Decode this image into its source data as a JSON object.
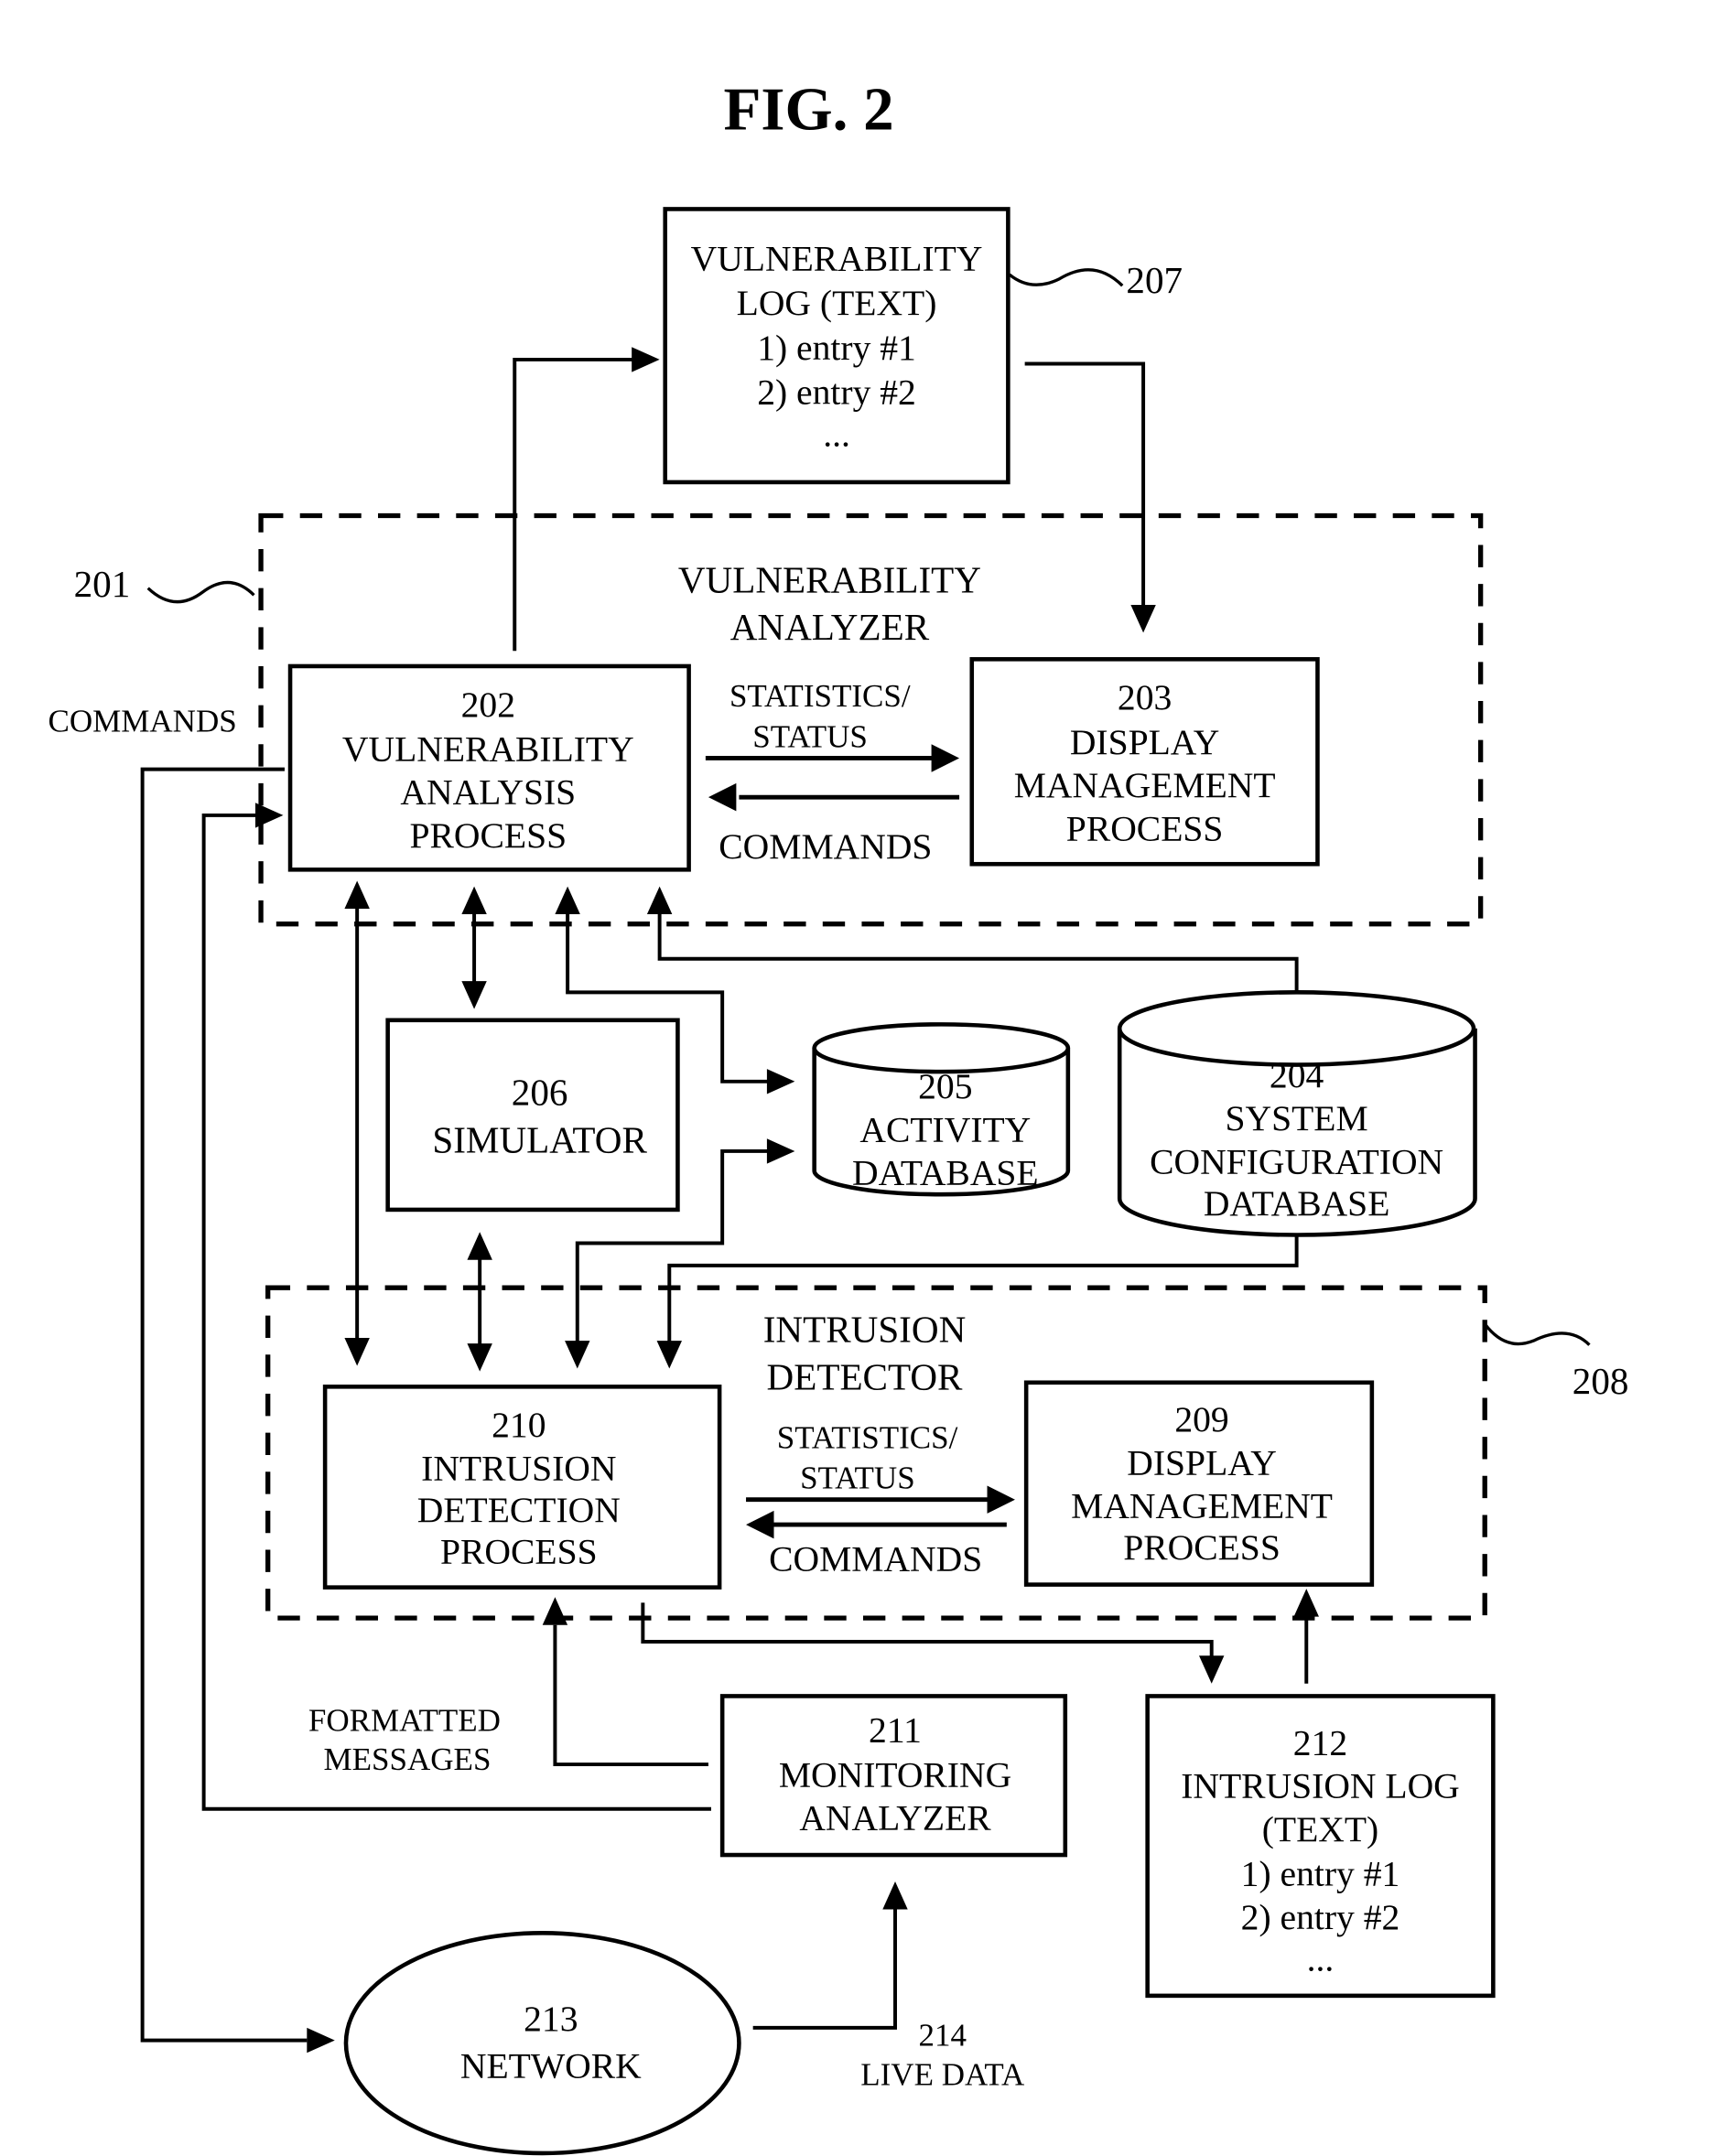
{
  "figure": {
    "title": "FIG. 2"
  },
  "groups": {
    "vulnerability_analyzer": {
      "ref": "201",
      "title_lines": [
        "VULNERABILITY",
        "ANALYZER"
      ]
    },
    "intrusion_detector": {
      "ref": "208",
      "title_lines": [
        "INTRUSION",
        "DETECTOR"
      ]
    }
  },
  "nodes": {
    "vulnerability_log": {
      "ref": "207",
      "lines": [
        "VULNERABILITY",
        "LOG (TEXT)",
        "1) entry #1",
        "2) entry #2",
        "..."
      ]
    },
    "vulnerability_analysis_process": {
      "lines": [
        "202",
        "VULNERABILITY",
        "ANALYSIS",
        "PROCESS"
      ]
    },
    "display_management_203": {
      "lines": [
        "203",
        "DISPLAY",
        "MANAGEMENT",
        "PROCESS"
      ]
    },
    "simulator": {
      "lines": [
        "206",
        "SIMULATOR"
      ]
    },
    "activity_database": {
      "lines": [
        "205",
        "ACTIVITY",
        "DATABASE"
      ]
    },
    "system_configuration_database": {
      "lines": [
        "204",
        "SYSTEM",
        "CONFIGURATION",
        "DATABASE"
      ]
    },
    "intrusion_detection_process": {
      "lines": [
        "210",
        "INTRUSION",
        "DETECTION",
        "PROCESS"
      ]
    },
    "display_management_209": {
      "lines": [
        "209",
        "DISPLAY",
        "MANAGEMENT",
        "PROCESS"
      ]
    },
    "monitoring_analyzer": {
      "lines": [
        "211",
        "MONITORING",
        "ANALYZER"
      ]
    },
    "intrusion_log": {
      "lines": [
        "212",
        "INTRUSION LOG",
        "(TEXT)",
        "1) entry #1",
        "2) entry #2",
        "..."
      ]
    },
    "network": {
      "lines": [
        "213",
        "NETWORK"
      ]
    }
  },
  "edge_labels": {
    "stats_top": [
      "STATISTICS/",
      "STATUS"
    ],
    "commands_top": "COMMANDS",
    "stats_bottom": [
      "STATISTICS/",
      "STATUS"
    ],
    "commands_bottom": "COMMANDS",
    "commands_left": "COMMANDS",
    "formatted_messages": [
      "FORMATTED",
      "MESSAGES"
    ],
    "live_data": [
      "214",
      "LIVE DATA"
    ]
  }
}
